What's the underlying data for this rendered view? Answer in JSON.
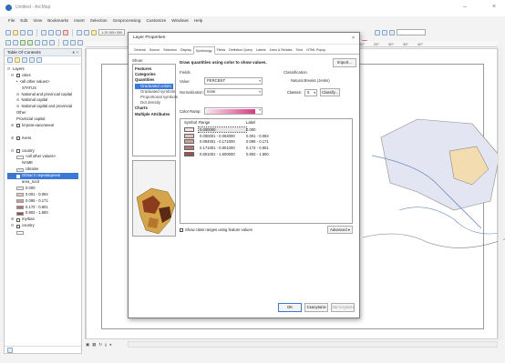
{
  "window": {
    "title": "Untitled - ArcMap",
    "minimize": "–",
    "close": "×"
  },
  "menu": [
    "File",
    "Edit",
    "View",
    "Bookmarks",
    "Insert",
    "Selection",
    "Geoprocessing",
    "Customize",
    "Windows",
    "Help"
  ],
  "toolbar": {
    "scale": "1:20 000 000",
    "status_combo": ""
  },
  "toc": {
    "title": "Table Of Contents",
    "pin": "ᴥ ×",
    "items": [
      {
        "label": "Layers",
        "level": 0,
        "checkbox": false,
        "expand": "⊟"
      },
      {
        "label": "cities",
        "level": 1,
        "checkbox": true,
        "expand": "⊟"
      },
      {
        "label": "<all other values>",
        "level": 2,
        "checkbox": false,
        "marker": "•"
      },
      {
        "label": "STATUS",
        "level": 3,
        "checkbox": false
      },
      {
        "label": "National and provincial capital",
        "level": 2,
        "checkbox": false,
        "marker": "⊙"
      },
      {
        "label": "National capital",
        "level": 2,
        "checkbox": false,
        "marker": "⊙"
      },
      {
        "label": "National capital and provincial",
        "level": 2,
        "checkbox": false,
        "marker": "⊙"
      },
      {
        "label": "Other",
        "level": 2,
        "checkbox": false
      },
      {
        "label": "Provincial capital",
        "level": 2,
        "checkbox": false
      },
      {
        "label": "kiтраїн-населення",
        "level": 1,
        "checkbox": true,
        "expand": "⊞"
      },
      {
        "label": "",
        "level": 1,
        "checkbox": false
      },
      {
        "label": "rivers",
        "level": 1,
        "checkbox": true,
        "expand": "⊞"
      },
      {
        "label": "",
        "level": 1,
        "checkbox": false
      },
      {
        "label": "country",
        "level": 1,
        "checkbox": true,
        "expand": "⊟"
      },
      {
        "label": "<all other values>",
        "level": 2,
        "checkbox": false,
        "swatch": "#ffffff"
      },
      {
        "label": "NAME",
        "level": 3,
        "checkbox": false
      },
      {
        "label": "Ukraine",
        "level": 2,
        "checkbox": false,
        "swatch": "#e7e7f2"
      },
      {
        "label": "Області переміщення",
        "level": 1,
        "checkbox": true,
        "expand": "⊟",
        "selected": true
      },
      {
        "label": "area_sccit",
        "level": 3,
        "checkbox": false
      },
      {
        "label": "0.000",
        "level": 2,
        "checkbox": false,
        "swatch": "#f4e8e8"
      },
      {
        "label": "0.001 - 0.094",
        "level": 2,
        "checkbox": false,
        "swatch": "#e4c4c2"
      },
      {
        "label": "0.095 - 0.171",
        "level": 2,
        "checkbox": false,
        "swatch": "#cf9d99"
      },
      {
        "label": "0.172 - 0.801",
        "level": 2,
        "checkbox": false,
        "swatch": "#b07370"
      },
      {
        "label": "0.802 - 1.600",
        "level": 2,
        "checkbox": false,
        "swatch": "#8f4f4b"
      },
      {
        "label": "myrban",
        "level": 1,
        "checkbox": true,
        "expand": "⊞"
      },
      {
        "label": "country",
        "level": 1,
        "checkbox": true,
        "expand": "⊟"
      },
      {
        "label": "",
        "level": 2,
        "checkbox": false,
        "swatch": "#ffffff"
      }
    ]
  },
  "dialog": {
    "title": "Layer Properties",
    "close": "×",
    "tabs": [
      "General",
      "Source",
      "Selection",
      "Display",
      "Symbology",
      "Fields",
      "Definition Query",
      "Labels",
      "Joins & Relates",
      "Time",
      "HTML Popup"
    ],
    "active_tab": "Symbology",
    "show_label": "Show:",
    "show_items": [
      {
        "label": "Features",
        "type": "b"
      },
      {
        "label": "Categories",
        "type": "b"
      },
      {
        "label": "Quantities",
        "type": "b"
      },
      {
        "label": "Graduated colors",
        "type": "sub",
        "selected": true
      },
      {
        "label": "Graduated symbols",
        "type": "sub"
      },
      {
        "label": "Proportional symbols",
        "type": "sub"
      },
      {
        "label": "Dot density",
        "type": "sub"
      },
      {
        "label": "Charts",
        "type": "b"
      },
      {
        "label": "Multiple Attributes",
        "type": "b"
      }
    ],
    "description": "Draw quantities using color to show values.",
    "import": "Import...",
    "fields_label": "Fields",
    "value_label": "Value:",
    "value": "PERCENT",
    "normalization_label": "Normalization:",
    "normalization": "none",
    "classification_label": "Classification",
    "classification_method": "Natural Breaks (Jenks)",
    "classes_label": "Classes:",
    "classes": "5",
    "classify": "Classify...",
    "color_ramp_label": "Color Ramp:",
    "table_headers": {
      "symbol": "Symbol",
      "range": "Range",
      "label": "Label"
    },
    "rows": [
      {
        "range": "0.000000",
        "label": "0.000",
        "color": "#f2e3e2"
      },
      {
        "range": "0.000001 - 0.094000",
        "label": "0.001 - 0.094",
        "color": "#e3c2bf"
      },
      {
        "range": "0.094001 - 0.171000",
        "label": "0.095 - 0.171",
        "color": "#cf9f9a"
      },
      {
        "range": "0.171001 - 0.801000",
        "label": "0.172 - 0.801",
        "color": "#b37a74"
      },
      {
        "range": "0.801001 - 1.600000",
        "label": "0.802 - 1.600",
        "color": "#97524c"
      }
    ],
    "show_ranges": "Show class ranges using feature values",
    "advanced": "Advanced ▾",
    "ok": "OK",
    "cancel": "Скасувати",
    "apply": "Застосувати"
  },
  "map": {
    "legend_snippet": "0.802 - 1.600",
    "ruler_labels": [
      "20°",
      "25°",
      "30°",
      "35°",
      "40°"
    ]
  },
  "colors": {
    "accent": "#3c78d8",
    "ramp_start": "#fbe3ee",
    "ramp_end": "#d63b83"
  }
}
